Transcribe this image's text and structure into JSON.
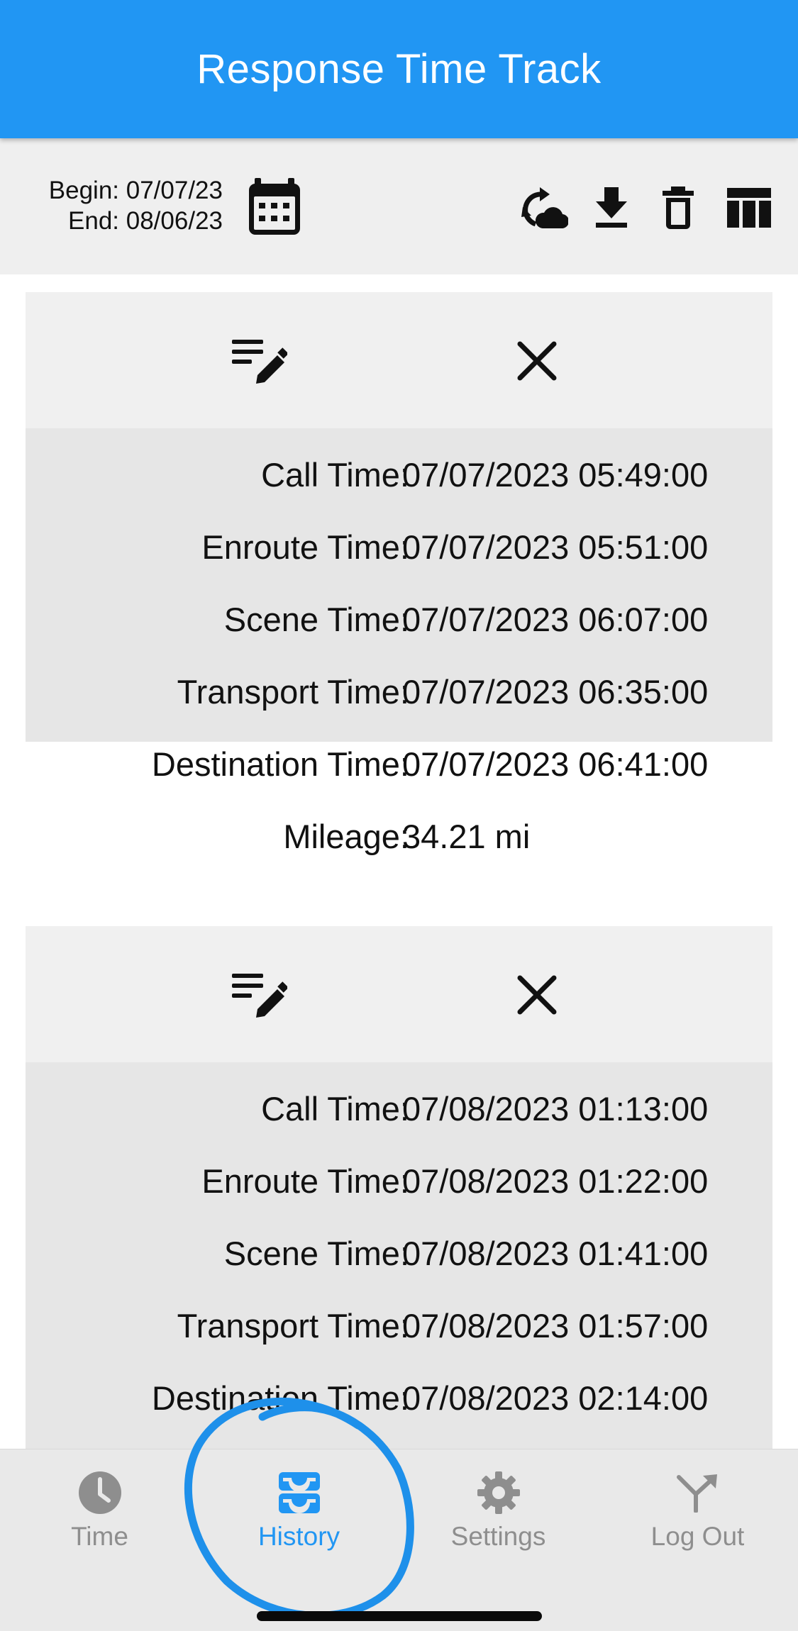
{
  "app": {
    "title": "Response Time Track"
  },
  "toolbar": {
    "begin_label": "Begin: 07/07/23",
    "end_label": "End: 08/06/23",
    "icons": [
      "calendar-icon",
      "cloud-sync-icon",
      "download-icon",
      "delete-icon",
      "table-icon"
    ]
  },
  "records": [
    {
      "fields": [
        {
          "label": "Call Time:",
          "value": "07/07/2023 05:49:00"
        },
        {
          "label": "Enroute Time:",
          "value": "07/07/2023 05:51:00"
        },
        {
          "label": "Scene Time:",
          "value": "07/07/2023 06:07:00"
        },
        {
          "label": "Transport Time:",
          "value": "07/07/2023 06:35:00"
        },
        {
          "label": "Destination Time:",
          "value": "07/07/2023 06:41:00"
        },
        {
          "label": "Mileage:",
          "value": "34.21 mi"
        }
      ]
    },
    {
      "fields": [
        {
          "label": "Call Time:",
          "value": "07/08/2023 01:13:00"
        },
        {
          "label": "Enroute Time:",
          "value": "07/08/2023 01:22:00"
        },
        {
          "label": "Scene Time:",
          "value": "07/08/2023 01:41:00"
        },
        {
          "label": "Transport Time:",
          "value": "07/08/2023 01:57:00"
        },
        {
          "label": "Destination Time:",
          "value": "07/08/2023 02:14:00"
        }
      ]
    }
  ],
  "nav": {
    "items": [
      {
        "label": "Time",
        "icon": "clock-icon"
      },
      {
        "label": "History",
        "icon": "inbox-icon"
      },
      {
        "label": "Settings",
        "icon": "gear-icon"
      },
      {
        "label": "Log Out",
        "icon": "merge-arrow-icon"
      }
    ],
    "active": "History"
  },
  "colors": {
    "primary": "#2196f3",
    "toolbar_bg": "#efefef",
    "card_head": "#f0f0f0",
    "card_body": "#e6e6e6",
    "nav_bg": "#e9e9e9",
    "nav_inactive": "#8e8e8e",
    "annotation": "#1e90ea"
  }
}
